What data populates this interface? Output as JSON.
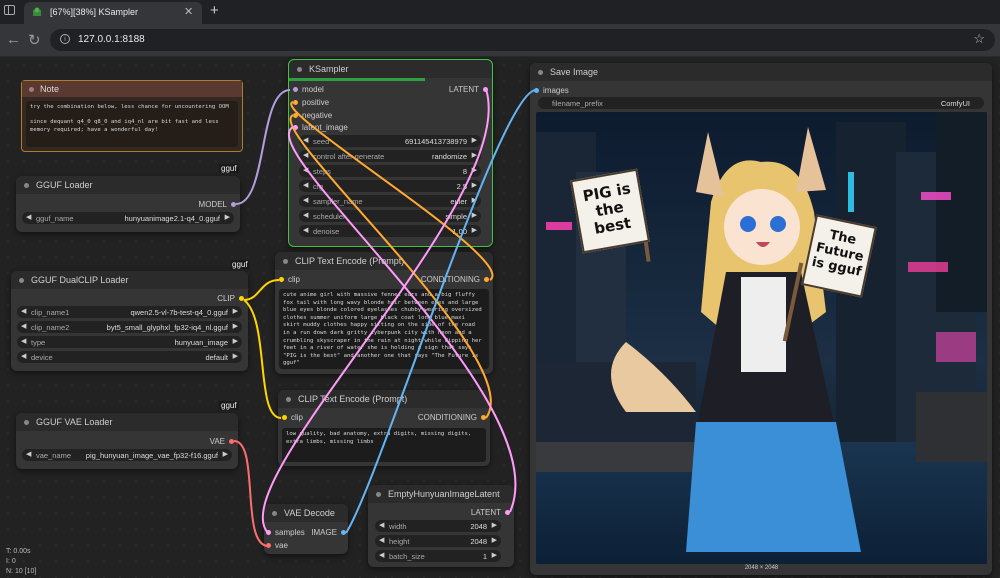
{
  "browser": {
    "tab_title": "[67%][38%] KSampler",
    "url": "127.0.0.1:8188"
  },
  "note": {
    "title": "Note",
    "text": "try the combination below, less chance for uncountering OOM\n\nsince dequant q4_0 q8_0 and iq4_nl are bit fast and less memory required; have a wonderful day!",
    "badge": "gguf"
  },
  "gguf_loader": {
    "title": "GGUF Loader",
    "output": "MODEL",
    "widget_label": "gguf_name",
    "widget_value": "hunyuanimage2.1-q4_0.gguf",
    "badge": "gguf"
  },
  "dualclip": {
    "title": "GGUF DualCLIP Loader",
    "output": "CLIP",
    "widgets": [
      {
        "label": "clip_name1",
        "value": "qwen2.5-vl-7b-test-q4_0.gguf"
      },
      {
        "label": "clip_name2",
        "value": "byt5_small_glyphxl_fp32-iq4_nl.gguf"
      },
      {
        "label": "type",
        "value": "hunyuan_image"
      },
      {
        "label": "device",
        "value": "default"
      }
    ],
    "badge": "gguf"
  },
  "vae_loader": {
    "title": "GGUF VAE Loader",
    "output": "VAE",
    "widget_label": "vae_name",
    "widget_value": "pig_hunyuan_image_vae_fp32-f16.gguf"
  },
  "ksampler": {
    "title": "KSampler",
    "inputs": [
      "model",
      "positive",
      "negative",
      "latent_image"
    ],
    "output": "LATENT",
    "progress": 0.67,
    "widgets": [
      {
        "label": "seed",
        "value": "691145413738979"
      },
      {
        "label": "control after generate",
        "value": "randomize"
      },
      {
        "label": "steps",
        "value": "8"
      },
      {
        "label": "cfg",
        "value": "2.5"
      },
      {
        "label": "sampler_name",
        "value": "euler"
      },
      {
        "label": "scheduler",
        "value": "simple"
      },
      {
        "label": "denoise",
        "value": "1.00"
      }
    ]
  },
  "clip_pos": {
    "title": "CLIP Text Encode (Prompt)",
    "input": "clip",
    "output": "CONDITIONING",
    "text": "cute anime girl with massive fennec ears and a big fluffy fox tail with long wavy blonde hair between eyes and large blue eyes blonde colored eyelashes chubby wearing oversized clothes summer uniform large black coat long blue maxi skirt muddy clothes happy sitting on the side of the road in a run down dark gritty cyberpunk city with neon and a crumbling skyscraper in the rain at night while dipping her feet in a river of water she is holding a sign that says \"PIG is the best\" and another one that says \"The Future is gguf\""
  },
  "clip_neg": {
    "title": "CLIP Text Encode (Prompt)",
    "input": "clip",
    "output": "CONDITIONING",
    "text": "low quality, bad anatomy, extra digits, missing digits, extra limbs, missing limbs"
  },
  "vae_decode": {
    "title": "VAE Decode",
    "inputs": [
      "samples",
      "vae"
    ],
    "output": "IMAGE"
  },
  "empty_latent": {
    "title": "EmptyHunyuanImageLatent",
    "output": "LATENT",
    "widgets": [
      {
        "label": "width",
        "value": "2048"
      },
      {
        "label": "height",
        "value": "2048"
      },
      {
        "label": "batch_size",
        "value": "1"
      }
    ]
  },
  "save_image": {
    "title": "Save Image",
    "input": "images",
    "widget_label": "filename_prefix",
    "widget_value": "ComfyUI",
    "dims": "2048 × 2048",
    "sign1": "PIG is the best",
    "sign2": "The Future is gguf"
  },
  "stats": {
    "t": "T: 0.00s",
    "i": "I: 0",
    "n": "N: 10 [10]"
  },
  "colors": {
    "model": "#b39ddb",
    "clip": "#ffd500",
    "conditioning": "#ffa931",
    "latent": "#ff9cf9",
    "vae": "#ff6e6e",
    "image": "#64b5f6",
    "progress": "#2ea043"
  }
}
